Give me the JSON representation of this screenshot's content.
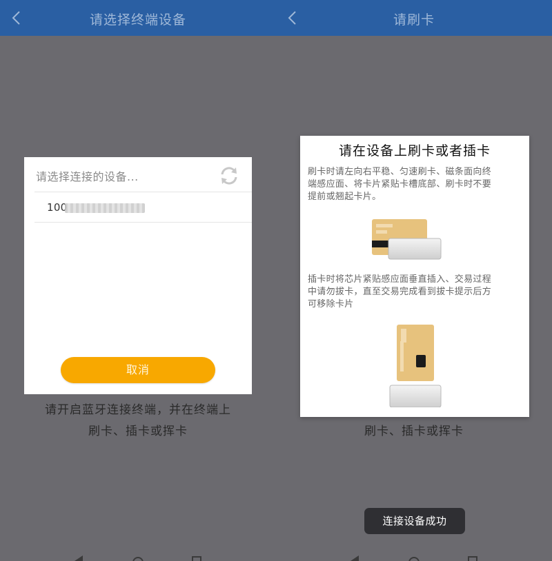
{
  "left_screen": {
    "header": {
      "title": "请选择终端设备",
      "back_icon": "chevron-left-icon"
    },
    "dialog": {
      "title": "请选择连接的设备...",
      "refresh_icon": "refresh-icon",
      "devices": [
        {
          "name_visible": "100"
        }
      ],
      "cancel_label": "取消"
    },
    "hint_lines": [
      "请开启蓝牙连接终端，并在终端上",
      "刷卡、插卡或挥卡"
    ]
  },
  "right_screen": {
    "header": {
      "title": "请刷卡",
      "back_icon": "chevron-left-icon"
    },
    "dialog": {
      "title": "请在设备上刷卡或者插卡",
      "swipe_lines": [
        "刷卡时请左向右平稳、匀速刷卡、磁条面向终",
        "端感应面、将卡片紧贴卡槽底部、刷卡时不要",
        "提前或翘起卡片。"
      ],
      "insert_lines": [
        "插卡时将芯片紧贴感应面垂直插入、交易过程",
        "中请勿拔卡，直至交易完成看到拔卡提示后方",
        "可移除卡片"
      ]
    },
    "hint_lines": [
      "刷卡、插卡或挥卡"
    ],
    "toast": "连接设备成功"
  },
  "colors": {
    "header_bg": "#2a5fa3",
    "backdrop": "#6b6a6f",
    "button_orange": "#f8a800",
    "card_gold": "#e7c27d",
    "toast_bg": "#2f2f33"
  }
}
